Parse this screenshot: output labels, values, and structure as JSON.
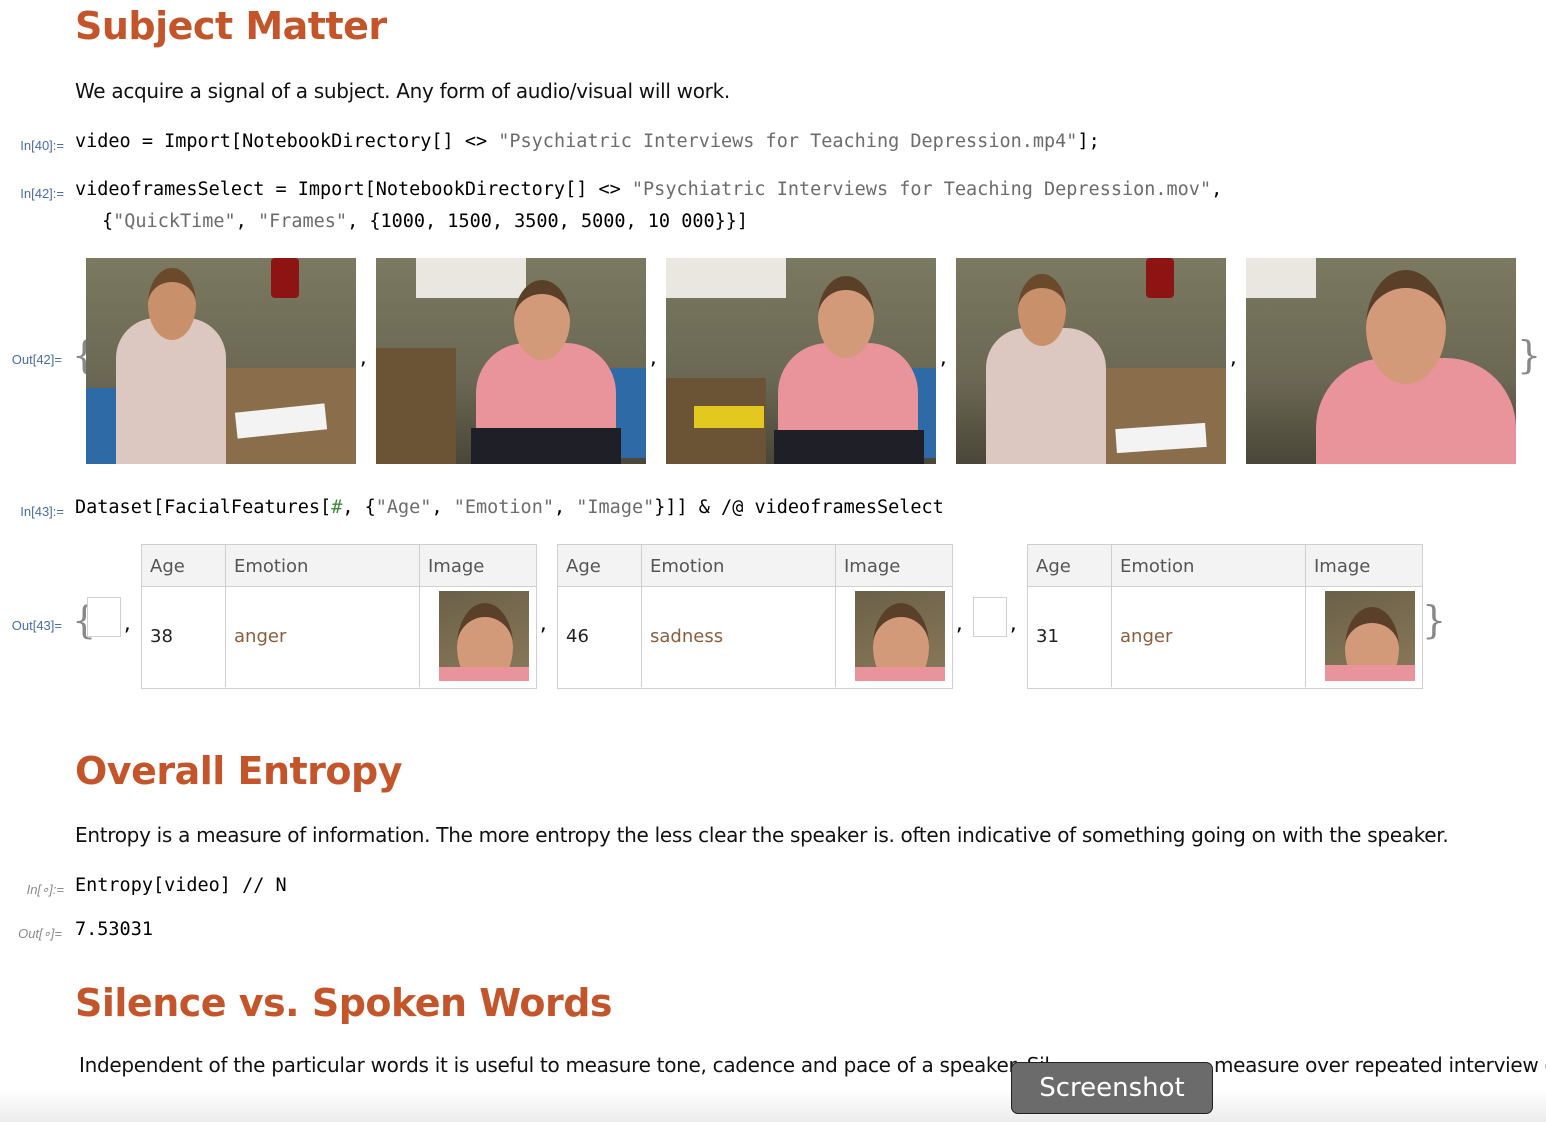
{
  "sections": {
    "subject": {
      "title": "Subject Matter",
      "body": "We acquire a signal of a subject.  Any form of audio/visual will work."
    },
    "entropy": {
      "title": "Overall Entropy",
      "body": "Entropy is a measure of information.  The more entropy the less clear the speaker is.  often indicative of something going on with the speaker."
    },
    "silence": {
      "title": "Silence vs. Spoken Words",
      "body_left": "Independent of the particular words it is useful to measure tone, cadence and pace of a speaker.  Sil",
      "body_right": "measure over repeated interview or"
    }
  },
  "cells": {
    "in40": {
      "label": "In[40]:=",
      "p1": "video = Import[NotebookDirectory[] <> ",
      "s1": "\"Psychiatric Interviews for Teaching Depression.mp4\"",
      "p2": "];"
    },
    "in42": {
      "label": "In[42]:=",
      "p1": "videoframesSelect = Import[NotebookDirectory[] <> ",
      "s1": "\"Psychiatric Interviews for Teaching Depression.mov\"",
      "p2": ",",
      "l2a": "{",
      "l2s1": "\"QuickTime\"",
      "l2b": ", ",
      "l2s2": "\"Frames\"",
      "l2c": ", {1000, 1500, 3500, 5000, 10 000}}]"
    },
    "out42": {
      "label": "Out[42]="
    },
    "in43": {
      "label": "In[43]:=",
      "p1": "Dataset[FacialFeatures[",
      "slot": "#",
      "p2": ", {",
      "s1": "\"Age\"",
      "p3": ", ",
      "s2": "\"Emotion\"",
      "p4": ", ",
      "s3": "\"Image\"",
      "p5": "}]] & /@ videoframesSelect"
    },
    "out43": {
      "label": "Out[43]="
    },
    "inE": {
      "label": "In[∘]:=",
      "code": "Entropy[video] // N"
    },
    "outE": {
      "label": "Out[∘]=",
      "value": "7.53031"
    }
  },
  "datasets": [
    {
      "headers": [
        "Age",
        "Emotion",
        "Image"
      ],
      "age": "38",
      "emotion": "anger"
    },
    {
      "headers": [
        "Age",
        "Emotion",
        "Image"
      ],
      "age": "46",
      "emotion": "sadness"
    },
    {
      "headers": [
        "Age",
        "Emotion",
        "Image"
      ],
      "age": "31",
      "emotion": "anger"
    }
  ],
  "tooltip": {
    "text": "Screenshot"
  },
  "colors": {
    "section_title": "#c4552b",
    "cell_label": "#4a6ea0",
    "string": "#6c6c6c"
  }
}
